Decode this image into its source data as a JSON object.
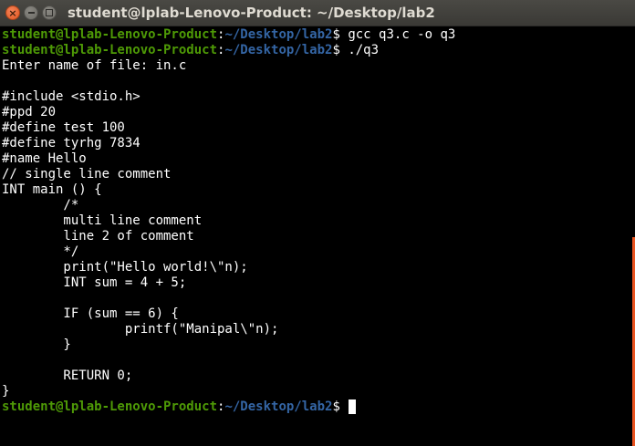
{
  "window": {
    "title": "student@lplab-Lenovo-Product: ~/Desktop/lab2"
  },
  "prompt": {
    "user_host": "student@lplab-Lenovo-Product",
    "separator": ":",
    "path": "~/Desktop/lab2",
    "symbol": "$ "
  },
  "commands": [
    "gcc q3.c -o q3",
    "./q3",
    ""
  ],
  "output_lines": [
    "Enter name of file: in.c",
    "",
    "#include <stdio.h>",
    "#ppd 20",
    "#define test 100",
    "#define tyrhg 7834",
    "#name Hello",
    "// single line comment",
    "INT main () {",
    "        /*",
    "        multi line comment",
    "        line 2 of comment",
    "        */",
    "        print(\"Hello world!\\\"n);",
    "        INT sum = 4 + 5;",
    "",
    "        IF (sum == 6) {",
    "                printf(\"Manipal\\\"n);",
    "        }",
    "",
    "        RETURN 0;",
    "}"
  ],
  "colors": {
    "prompt_user": "#4e9a06",
    "prompt_path": "#3465a4",
    "close_button": "#e0561f",
    "scrollbar": "#e95420"
  }
}
